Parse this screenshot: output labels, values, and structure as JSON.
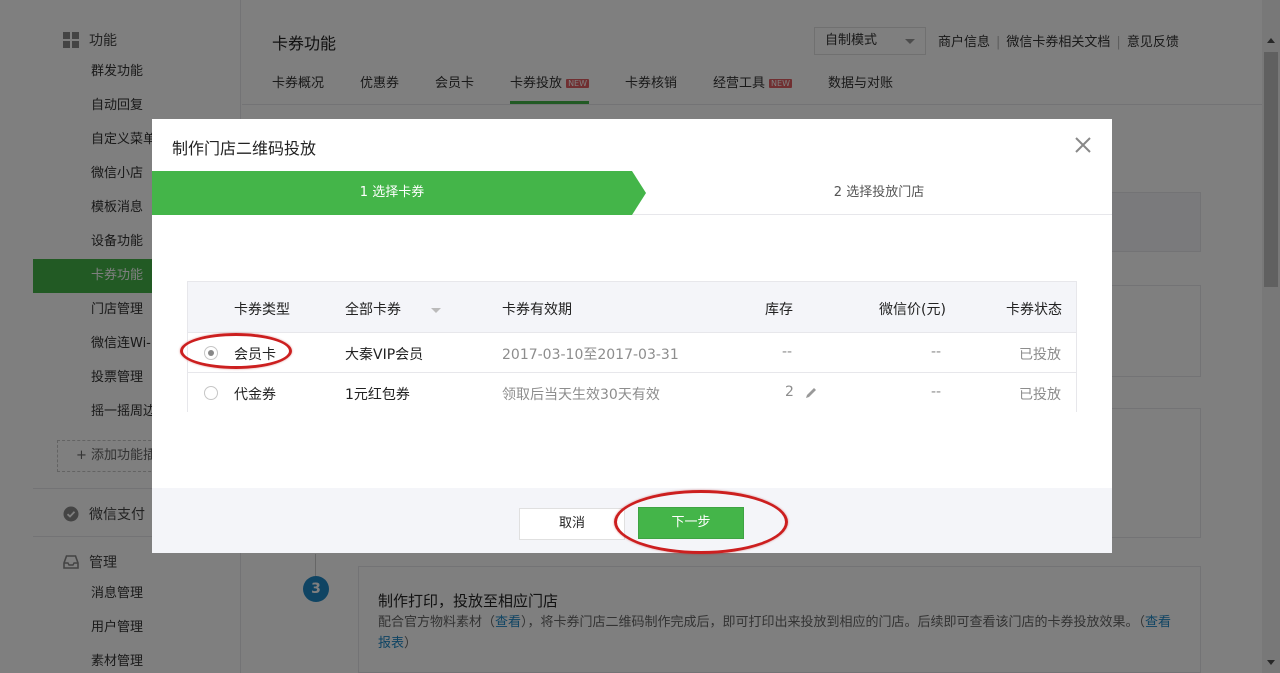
{
  "sidebar": {
    "group_function": "功能",
    "items": [
      "群发功能",
      "自动回复",
      "自定义菜单",
      "微信小店",
      "模板消息",
      "设备功能",
      "卡券功能",
      "门店管理",
      "微信连Wi-Fi",
      "投票管理",
      "摇一摇周边"
    ],
    "active_index": 6,
    "add_label": "+ 添加功能插件",
    "group_pay": "微信支付",
    "group_manage": "管理",
    "manage_items": [
      "消息管理",
      "用户管理",
      "素材管理"
    ]
  },
  "header": {
    "title": "卡券功能",
    "mode_select": "自制模式",
    "links": [
      "商户信息",
      "微信卡券相关文档",
      "意见反馈"
    ]
  },
  "tabs": [
    {
      "label": "卡券概况",
      "new": false
    },
    {
      "label": "优惠券",
      "new": false
    },
    {
      "label": "会员卡",
      "new": false
    },
    {
      "label": "卡券投放",
      "new": true
    },
    {
      "label": "卡券核销",
      "new": false
    },
    {
      "label": "经营工具",
      "new": true
    },
    {
      "label": "数据与对账",
      "new": false
    }
  ],
  "new_badge": "NEW",
  "step3": {
    "number": "3",
    "title": "制作打印，投放至相应门店",
    "desc_a": "配合官方物料素材（",
    "desc_link1": "查看",
    "desc_b": "），将卡券门店二维码制作完成后，即可打印出来投放到相应的门店。后续即可查看该门店的卡券投放效果。（",
    "desc_link2": "查看报表",
    "desc_c": "）"
  },
  "dialog": {
    "title": "制作门店二维码投放",
    "step1": "1 选择卡券",
    "step2": "2 选择投放门店",
    "columns": {
      "type": "卡券类型",
      "all": "全部卡券",
      "validity": "卡券有效期",
      "stock": "库存",
      "price": "微信价(元)",
      "status": "卡券状态"
    },
    "rows": [
      {
        "type": "会员卡",
        "name": "大秦VIP会员",
        "validity": "2017-03-10至2017-03-31",
        "stock": "--",
        "price": "--",
        "status": "已投放",
        "checked": true
      },
      {
        "type": "代金券",
        "name": "1元红包券",
        "validity": "领取后当天生效30天有效",
        "stock": "2",
        "price": "--",
        "status": "已投放",
        "checked": false
      }
    ],
    "cancel_label": "取消",
    "next_label": "下一步"
  },
  "colors": {
    "accent_green": "#44b549",
    "annotation_red": "#cc1f1f",
    "link_blue": "#1e88c7"
  }
}
